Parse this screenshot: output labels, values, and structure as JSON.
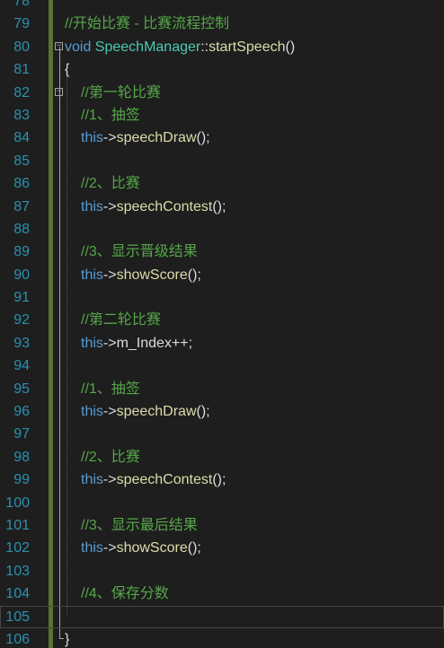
{
  "lines": [
    {
      "num": "78",
      "parts": []
    },
    {
      "num": "79",
      "parts": [
        {
          "cls": "comment",
          "text": "//开始比赛 - 比赛流程控制"
        }
      ]
    },
    {
      "num": "80",
      "fold": "−",
      "parts": [
        {
          "cls": "kw",
          "text": "void "
        },
        {
          "cls": "type",
          "text": "SpeechManager"
        },
        {
          "cls": "txt",
          "text": "::"
        },
        {
          "cls": "fn",
          "text": "startSpeech"
        },
        {
          "cls": "txt",
          "text": "()"
        }
      ]
    },
    {
      "num": "81",
      "parts": [
        {
          "cls": "txt",
          "text": "{"
        }
      ]
    },
    {
      "num": "82",
      "fold": "−",
      "indent": true,
      "parts": [
        {
          "cls": "comment",
          "text": "//第一轮比赛"
        }
      ]
    },
    {
      "num": "83",
      "indent": true,
      "parts": [
        {
          "cls": "comment",
          "text": "//1、抽签"
        }
      ]
    },
    {
      "num": "84",
      "indent": true,
      "parts": [
        {
          "cls": "kw",
          "text": "this"
        },
        {
          "cls": "txt",
          "text": "->"
        },
        {
          "cls": "fn",
          "text": "speechDraw"
        },
        {
          "cls": "txt",
          "text": "();"
        }
      ]
    },
    {
      "num": "85",
      "parts": []
    },
    {
      "num": "86",
      "indent": true,
      "parts": [
        {
          "cls": "comment",
          "text": "//2、比赛"
        }
      ]
    },
    {
      "num": "87",
      "indent": true,
      "parts": [
        {
          "cls": "kw",
          "text": "this"
        },
        {
          "cls": "txt",
          "text": "->"
        },
        {
          "cls": "fn",
          "text": "speechContest"
        },
        {
          "cls": "txt",
          "text": "();"
        }
      ]
    },
    {
      "num": "88",
      "parts": []
    },
    {
      "num": "89",
      "indent": true,
      "parts": [
        {
          "cls": "comment",
          "text": "//3、显示晋级结果"
        }
      ]
    },
    {
      "num": "90",
      "indent": true,
      "parts": [
        {
          "cls": "kw",
          "text": "this"
        },
        {
          "cls": "txt",
          "text": "->"
        },
        {
          "cls": "fn",
          "text": "showScore"
        },
        {
          "cls": "txt",
          "text": "();"
        }
      ]
    },
    {
      "num": "91",
      "parts": []
    },
    {
      "num": "92",
      "indent": true,
      "parts": [
        {
          "cls": "comment",
          "text": "//第二轮比赛"
        }
      ]
    },
    {
      "num": "93",
      "indent": true,
      "parts": [
        {
          "cls": "kw",
          "text": "this"
        },
        {
          "cls": "txt",
          "text": "->m_Index++;"
        }
      ]
    },
    {
      "num": "94",
      "parts": []
    },
    {
      "num": "95",
      "indent": true,
      "parts": [
        {
          "cls": "comment",
          "text": "//1、抽签"
        }
      ]
    },
    {
      "num": "96",
      "indent": true,
      "parts": [
        {
          "cls": "kw",
          "text": "this"
        },
        {
          "cls": "txt",
          "text": "->"
        },
        {
          "cls": "fn",
          "text": "speechDraw"
        },
        {
          "cls": "txt",
          "text": "();"
        }
      ]
    },
    {
      "num": "97",
      "parts": []
    },
    {
      "num": "98",
      "indent": true,
      "parts": [
        {
          "cls": "comment",
          "text": "//2、比赛"
        }
      ]
    },
    {
      "num": "99",
      "indent": true,
      "parts": [
        {
          "cls": "kw",
          "text": "this"
        },
        {
          "cls": "txt",
          "text": "->"
        },
        {
          "cls": "fn",
          "text": "speechContest"
        },
        {
          "cls": "txt",
          "text": "();"
        }
      ]
    },
    {
      "num": "100",
      "parts": []
    },
    {
      "num": "101",
      "indent": true,
      "parts": [
        {
          "cls": "comment",
          "text": "//3、显示最后结果"
        }
      ]
    },
    {
      "num": "102",
      "indent": true,
      "parts": [
        {
          "cls": "kw",
          "text": "this"
        },
        {
          "cls": "txt",
          "text": "->"
        },
        {
          "cls": "fn",
          "text": "showScore"
        },
        {
          "cls": "txt",
          "text": "();"
        }
      ]
    },
    {
      "num": "103",
      "parts": []
    },
    {
      "num": "104",
      "indent": true,
      "parts": [
        {
          "cls": "comment",
          "text": "//4、保存分数"
        }
      ]
    },
    {
      "num": "105",
      "current": true,
      "parts": []
    },
    {
      "num": "106",
      "parts": [
        {
          "cls": "txt",
          "text": "}"
        }
      ]
    }
  ],
  "colors": {
    "background": "#1e1e1e",
    "line_number": "#2b91af",
    "comment": "#57a64a",
    "keyword": "#569cd6",
    "type": "#4ec9b0",
    "function": "#dcdcaa",
    "text": "#dcdcdc",
    "change_bar": "#577430"
  },
  "icons": {
    "fold": "collapse-minus-icon"
  }
}
